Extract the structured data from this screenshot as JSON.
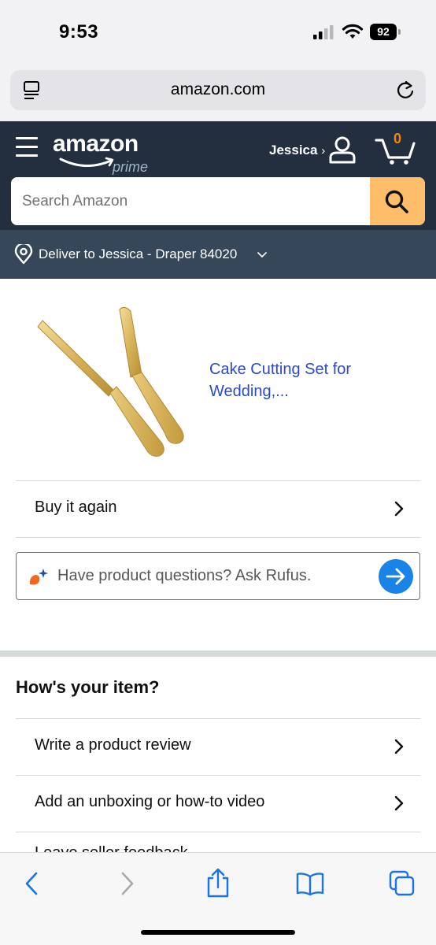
{
  "status_bar": {
    "time": "9:53",
    "battery": "92"
  },
  "browser": {
    "url": "amazon.com"
  },
  "header": {
    "logo_text": "amazon",
    "logo_sub": "prime",
    "account_name": "Jessica",
    "account_chevron": "›",
    "cart_count": "0",
    "search_placeholder": "Search Amazon"
  },
  "delivery": {
    "text": "Deliver to Jessica - Draper 84020"
  },
  "product": {
    "title": "Cake Cutting Set for Wedding,...",
    "image_icon": "gold-cake-knife-server-image"
  },
  "rows": {
    "buy_again": "Buy it again",
    "rufus_prompt": "Have product questions? Ask Rufus."
  },
  "feedback": {
    "title": "How's your item?",
    "items": [
      "Write a product review",
      "Add an unboxing or how-to video",
      "Leave seller feedback"
    ]
  },
  "colors": {
    "header_bg": "#232f3e",
    "delivery_bg": "#37475a",
    "search_button": "#febd69",
    "link_blue": "#2b49c8",
    "rufus_button": "#1a83e8",
    "cart_count": "#f08804"
  }
}
